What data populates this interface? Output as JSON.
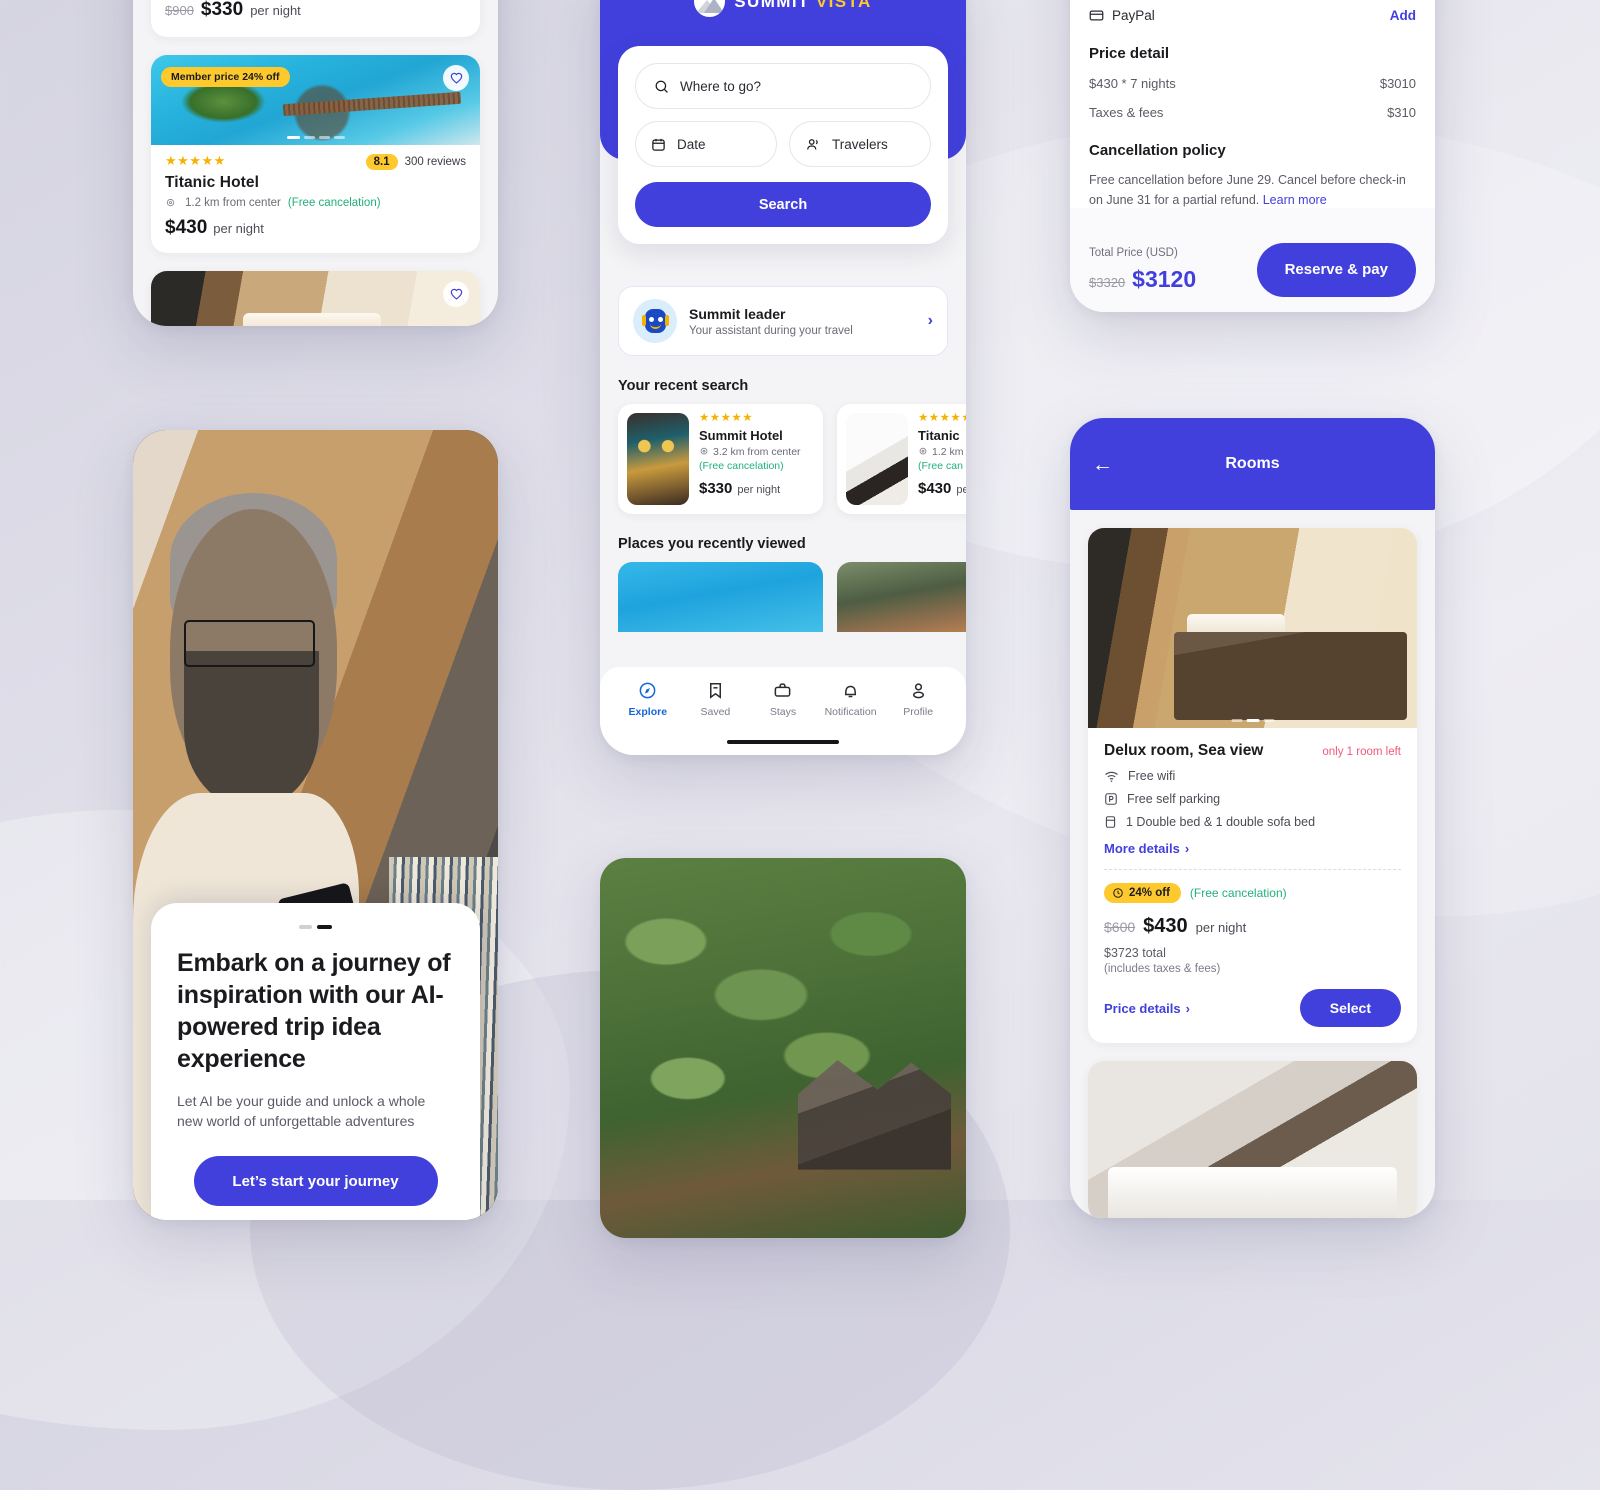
{
  "brand": {
    "name_primary": "SUMMIT",
    "name_secondary": "VISTA",
    "logo_icon": "mountain-sun-icon"
  },
  "colors": {
    "accent": "#4240dc",
    "badge_yellow": "#fdc92d",
    "success_green": "#23b07a",
    "alert_pink": "#f2587b",
    "score_yellow": "#fdc92d"
  },
  "results_screen": {
    "partial_card": {
      "price_old": "$900",
      "price_new": "$330",
      "price_unit": "per night"
    },
    "hotel_card": {
      "badge": "Member price 24% off",
      "favorite_icon": "heart-icon",
      "stars": "★★★★★",
      "score": "8.1",
      "reviews": "300 reviews",
      "name": "Titanic  Hotel",
      "distance": "1.2 km from center",
      "cancellation": "(Free cancelation)",
      "price_new": "$430",
      "price_unit": "per night",
      "carousel_dots": 4,
      "carousel_active": 0
    },
    "bottom_card": {
      "favorite_icon": "heart-icon"
    }
  },
  "explore_screen": {
    "search": {
      "destination_placeholder": "Where to go?",
      "destination_icon": "search-icon",
      "date_label": "Date",
      "date_icon": "calendar-icon",
      "travelers_label": "Travelers",
      "travelers_icon": "people-icon",
      "search_button": "Search"
    },
    "assistant": {
      "avatar_icon": "robot-icon",
      "title": "Summit leader",
      "subtitle": "Your assistant during your travel",
      "chevron_icon": "chevron-right-icon"
    },
    "recent_search_title": "Your recent search",
    "recent_searches": [
      {
        "thumb": "lobby-thumbnail",
        "stars": "★★★★★",
        "name": "Summit Hotel",
        "distance": "3.2 km from center",
        "cancellation": "(Free cancelation)",
        "price": "$330",
        "price_unit": "per night"
      },
      {
        "thumb": "towel-thumbnail",
        "stars": "★★★★★",
        "name": "Titanic",
        "distance": "1.2 km",
        "cancellation": "(Free can",
        "price": "$430",
        "price_unit": "pe"
      }
    ],
    "viewed_title": "Places you recently viewed",
    "viewed_places": [
      {
        "thumb": "pool-photo"
      },
      {
        "thumb": "garden-photo"
      }
    ],
    "tabs": [
      {
        "label": "Explore",
        "icon": "compass-icon",
        "active": true
      },
      {
        "label": "Saved",
        "icon": "bookmark-icon",
        "active": false
      },
      {
        "label": "Stays",
        "icon": "briefcase-icon",
        "active": false
      },
      {
        "label": "Notification",
        "icon": "bell-icon",
        "active": false
      },
      {
        "label": "Profile",
        "icon": "person-icon",
        "active": false
      }
    ]
  },
  "jungle_screen": {
    "photo": "tropical-jungle-resort-photo"
  },
  "onboarding_screen": {
    "photo": "man-with-phone-photo",
    "heading": "Embark on a journey of inspiration with our AI-powered trip idea experience",
    "subtext": "Let AI be your guide and unlock a whole new world of unforgettable adventures",
    "cta": "Let’s start your journey"
  },
  "checkout_screen": {
    "payment_method": "PayPal",
    "payment_icon": "card-icon",
    "add_link": "Add",
    "price_detail_title": "Price detail",
    "lines": [
      {
        "label": "$430 * 7 nights",
        "value": "$3010"
      },
      {
        "label": "Taxes & fees",
        "value": "$310"
      }
    ],
    "cancellation_title": "Cancellation policy",
    "cancellation_text": "Free cancellation before June 29. Cancel before check-in on June 31 for a partial refund. ",
    "learn_more": "Learn more",
    "total_label": "Total Price (USD)",
    "total_old": "$3320",
    "total_new": "$3120",
    "reserve_button": "Reserve & pay"
  },
  "rooms_screen": {
    "back_icon": "arrow-left-icon",
    "title": "Rooms",
    "room": {
      "photo": "delux-room-photo",
      "carousel_dots": 3,
      "carousel_active": 1,
      "name": "Delux room, Sea view",
      "availability": "only 1 room left",
      "amenities": [
        {
          "icon": "wifi-icon",
          "label": "Free wifi"
        },
        {
          "icon": "parking-icon",
          "label": "Free self parking"
        },
        {
          "icon": "bed-icon",
          "label": "1 Double bed & 1 double sofa bed"
        }
      ],
      "more_details": "More details",
      "discount_badge": "24% off",
      "discount_icon": "discount-icon",
      "cancellation": "(Free cancelation)",
      "price_old": "$600",
      "price_new": "$430",
      "price_unit": "per night",
      "total": "$3723 total",
      "includes": "(includes taxes & fees)",
      "price_details_link": "Price details",
      "select_button": "Select"
    },
    "next_room": {
      "photo": "twin-room-photo"
    }
  }
}
